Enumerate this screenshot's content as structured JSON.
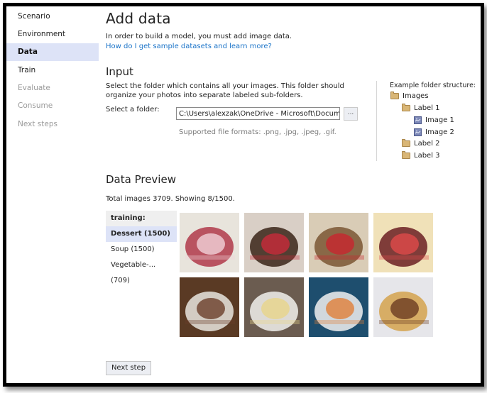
{
  "sidebar": {
    "items": [
      {
        "label": "Scenario",
        "state": "normal"
      },
      {
        "label": "Environment",
        "state": "normal"
      },
      {
        "label": "Data",
        "state": "active"
      },
      {
        "label": "Train",
        "state": "normal"
      },
      {
        "label": "Evaluate",
        "state": "disabled"
      },
      {
        "label": "Consume",
        "state": "disabled"
      },
      {
        "label": "Next steps",
        "state": "disabled"
      }
    ]
  },
  "page": {
    "title": "Add data",
    "description": "In order to build a model, you must add image data.",
    "help_link": "How do I get sample datasets and learn more?"
  },
  "input": {
    "heading": "Input",
    "description": "Select the folder which contains all your images. This folder should organize your photos into separate labeled sub-folders.",
    "folder_label": "Select a folder:",
    "folder_value": "C:\\Users\\alexzak\\OneDrive - Microsoft\\Documents\\",
    "browse_label": "...",
    "formats_text": "Supported file formats: .png, .jpg, .jpeg, .gif."
  },
  "example": {
    "title": "Example folder structure:",
    "tree": [
      {
        "label": "Images",
        "icon": "folder-icon",
        "level": 0
      },
      {
        "label": "Label 1",
        "icon": "folder-icon",
        "level": 1
      },
      {
        "label": "Image 1",
        "icon": "image-icon",
        "level": 2
      },
      {
        "label": "Image 2",
        "icon": "image-icon",
        "level": 2
      },
      {
        "label": "Label 2",
        "icon": "folder-icon",
        "level": 1
      },
      {
        "label": "Label 3",
        "icon": "folder-icon",
        "level": 1
      }
    ]
  },
  "preview": {
    "heading": "Data Preview",
    "count_text": "Total images 3709. Showing 8/1500.",
    "group_header": "training:",
    "classes": [
      {
        "label": "Dessert (1500)",
        "selected": true
      },
      {
        "label": "Soup (1500)",
        "selected": false
      },
      {
        "label": "Vegetable-... (709)",
        "selected": false
      }
    ],
    "thumbnails": [
      {
        "name": "layered-cake",
        "colors": [
          "#e8e4dc",
          "#b03a4a",
          "#f1d2d8"
        ]
      },
      {
        "name": "dessert-plate-chocolate",
        "colors": [
          "#d9cfc6",
          "#3a2418",
          "#c92a3a"
        ]
      },
      {
        "name": "tiramisu-slice",
        "colors": [
          "#d9ccb6",
          "#7a5634",
          "#c8252e"
        ]
      },
      {
        "name": "red-velvet-cake",
        "colors": [
          "#f0e1b8",
          "#6b1e22",
          "#e04a4a"
        ]
      },
      {
        "name": "tiramisu-on-plate",
        "colors": [
          "#5a3a24",
          "#e9e6df",
          "#6c3f2a"
        ]
      },
      {
        "name": "cheesecake-slice",
        "colors": [
          "#6b5c50",
          "#f1f0ec",
          "#e8d48a"
        ]
      },
      {
        "name": "macarons-box",
        "colors": [
          "#1e4e6e",
          "#f1f1f1",
          "#e0803a"
        ]
      },
      {
        "name": "waffle-strawberries",
        "colors": [
          "#e6e6ea",
          "#d4a24e",
          "#6b3b22"
        ]
      }
    ]
  },
  "footer": {
    "next_label": "Next step"
  }
}
